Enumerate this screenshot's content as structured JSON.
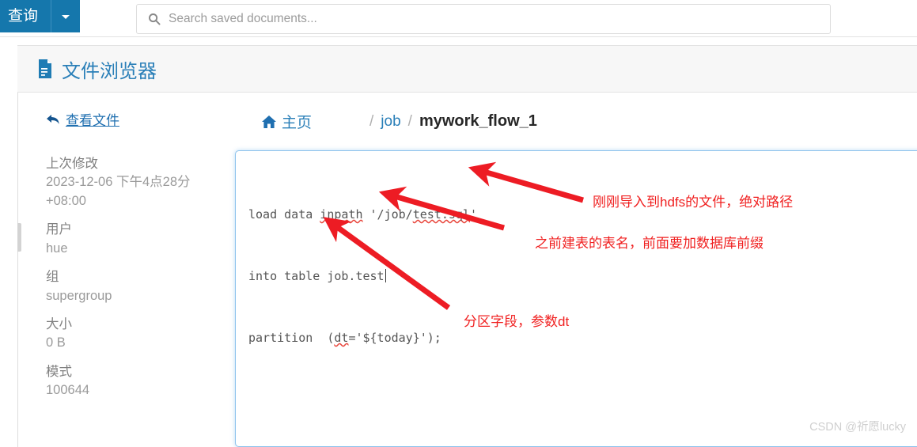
{
  "topbar": {
    "query_button_label": "查询",
    "query_caret_icon": "chevron-down-icon",
    "search_icon": "search-icon",
    "search_value": "",
    "search_placeholder": "Search saved documents..."
  },
  "app_header": {
    "icon": "document-icon",
    "title": "文件浏览器"
  },
  "sidebar": {
    "back_icon": "back-arrow-icon",
    "back_label": "查看文件",
    "meta": [
      {
        "label": "上次修改",
        "value": "2023-12-06 下午4点28分 +08:00"
      },
      {
        "label": "用户",
        "value": "hue"
      },
      {
        "label": "组",
        "value": "supergroup"
      },
      {
        "label": "大小",
        "value": "0 B"
      },
      {
        "label": "模式",
        "value": "100644"
      }
    ]
  },
  "breadcrumb": {
    "home_icon": "home-icon",
    "home_label": "主页",
    "sep": "/",
    "items": [
      {
        "label": "job",
        "current": false
      },
      {
        "label": "mywork_flow_1",
        "current": true
      }
    ]
  },
  "editor": {
    "lines": [
      {
        "segments": [
          {
            "t": "load data ",
            "squiggle": false
          },
          {
            "t": "inpath",
            "squiggle": true
          },
          {
            "t": " '/job/",
            "squiggle": false
          },
          {
            "t": "test.sql",
            "squiggle": true
          },
          {
            "t": "'",
            "squiggle": false
          }
        ]
      },
      {
        "segments": [
          {
            "t": "into table job.test",
            "squiggle": false
          }
        ],
        "caret": true
      },
      {
        "segments": [
          {
            "t": "partition  (",
            "squiggle": false
          },
          {
            "t": "dt",
            "squiggle": true
          },
          {
            "t": "='${today}');",
            "squiggle": false
          }
        ]
      }
    ],
    "full_text": "load data inpath '/job/test.sql'\ninto table job.test\npartition  (dt='${today}');"
  },
  "annotations": [
    {
      "id": "annotation-hdfs-path",
      "text": "刚刚导入到hdfs的文件，绝对路径",
      "color": "#f02020"
    },
    {
      "id": "annotation-table-name",
      "text": "之前建表的表名，前面要加数据库前缀",
      "color": "#f02020"
    },
    {
      "id": "annotation-partition-field",
      "text": "分区字段，参数dt",
      "color": "#f02020"
    }
  ],
  "watermark": {
    "text": "CSDN @祈愿lucky"
  }
}
